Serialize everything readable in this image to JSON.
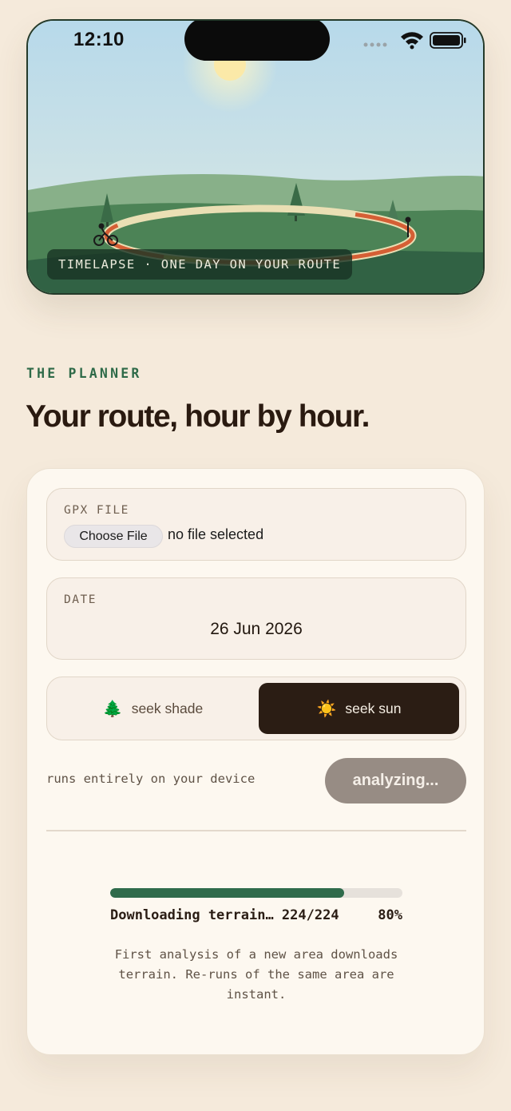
{
  "status_bar": {
    "time": "12:10",
    "icons": [
      "cellular-dots-icon",
      "wifi-icon",
      "battery-icon"
    ]
  },
  "hero": {
    "badge": "TIMELAPSE · ONE DAY ON YOUR ROUTE",
    "icons": [
      "sun-icon",
      "cyclist-icon",
      "finish-marker-icon"
    ]
  },
  "planner": {
    "eyebrow": "THE PLANNER",
    "title": "Your route, hour by hour."
  },
  "form": {
    "gpx": {
      "label": "GPX FILE",
      "button": "Choose File",
      "status": "no file selected"
    },
    "date": {
      "label": "DATE",
      "value": "26 Jun 2026"
    },
    "mode": {
      "shade_emoji": "🌲",
      "shade_label": "seek shade",
      "sun_emoji": "☀️",
      "sun_label": "seek sun",
      "selected": "seek sun"
    },
    "local_note": "runs entirely on your device",
    "analyze_button": "analyzing..."
  },
  "progress": {
    "label": "Downloading terrain… 224/224",
    "percent_text": "80%",
    "fraction": 0.8,
    "note": "First analysis of a new area downloads terrain. Re-runs of the same area are instant."
  },
  "colors": {
    "accent_green": "#2f6b4b",
    "dark_brown": "#2b1d14",
    "background": "#f5eadb",
    "card": "#fdf8f0",
    "button_disabled": "#978c84"
  }
}
